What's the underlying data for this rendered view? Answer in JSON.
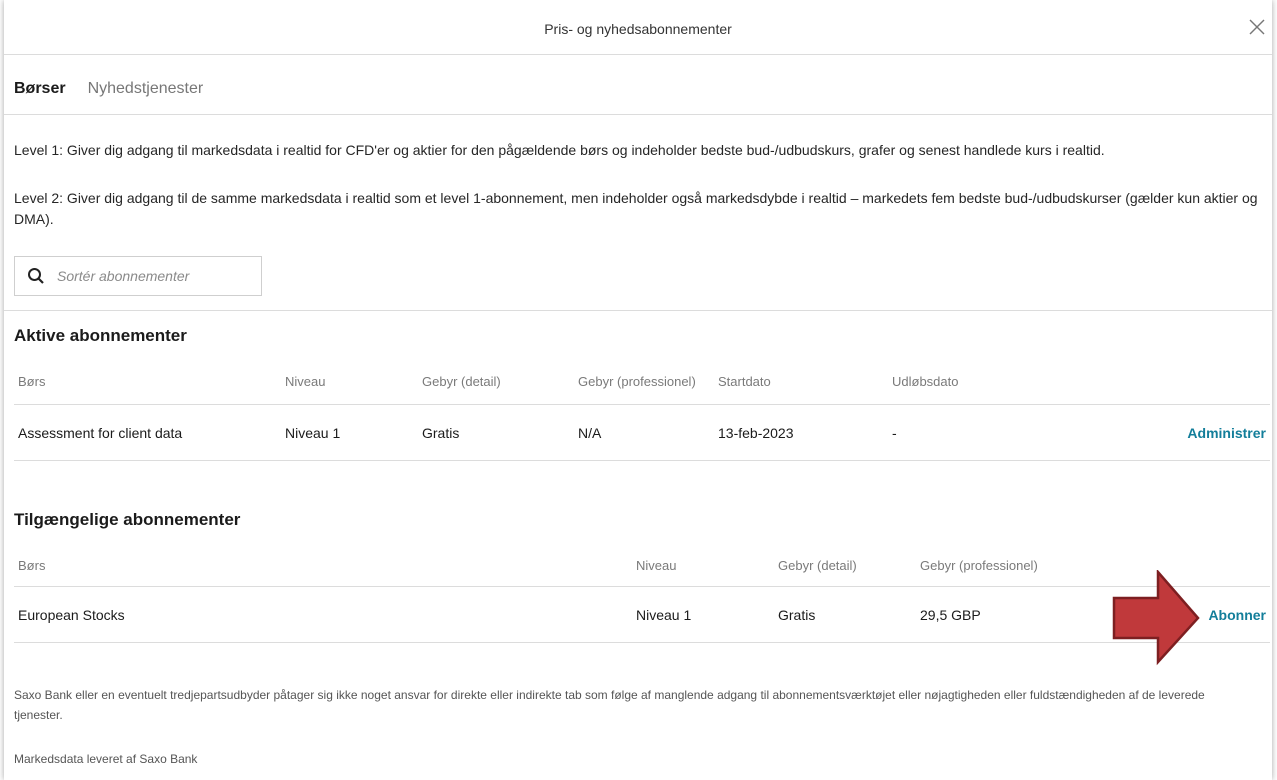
{
  "dialog": {
    "title": "Pris- og nyhedsabonnementer"
  },
  "tabs": [
    {
      "label": "Børser",
      "active": true
    },
    {
      "label": "Nyhedstjenester",
      "active": false
    }
  ],
  "intro": {
    "level1": "Level 1: Giver dig adgang til markedsdata i realtid for CFD'er og aktier for den pågældende børs og indeholder bedste bud-/udbudskurs, grafer og senest handlede kurs i realtid.",
    "level2": "Level 2: Giver dig adgang til de samme markedsdata i realtid som et level 1-abonnement, men indeholder også markedsdybde i realtid – markedets fem bedste bud-/udbudskurser (gælder kun aktier og DMA)."
  },
  "search": {
    "placeholder": "Sortér abonnementer",
    "value": ""
  },
  "active": {
    "heading": "Aktive abonnementer",
    "columns": [
      "Børs",
      "Niveau",
      "Gebyr (detail)",
      "Gebyr (professionel)",
      "Startdato",
      "Udløbsdato"
    ],
    "rows": [
      {
        "exchange": "Assessment for client data",
        "level": "Niveau 1",
        "fee_retail": "Gratis",
        "fee_pro": "N/A",
        "start": "13-feb-2023",
        "expiry": "-",
        "action": "Administrer"
      }
    ]
  },
  "available": {
    "heading": "Tilgængelige abonnementer",
    "columns": [
      "Børs",
      "Niveau",
      "Gebyr (detail)",
      "Gebyr (professionel)"
    ],
    "rows": [
      {
        "exchange": "European Stocks",
        "level": "Niveau 1",
        "fee_retail": "Gratis",
        "fee_pro": "29,5 GBP",
        "action": "Abonner"
      }
    ]
  },
  "footer": {
    "disclaimer": "Saxo Bank eller en eventuelt tredjepartsudbyder påtager sig ikke noget ansvar for direkte eller indirekte tab som følge af manglende adgang til abonnementsværktøjet eller nøjagtigheden eller fuldstændigheden af de leverede tjenester.",
    "provider": "Markedsdata leveret af Saxo Bank"
  },
  "colors": {
    "link": "#137e9a",
    "annotation_arrow": "#c0393b"
  },
  "icons": {
    "close": "close-icon",
    "search": "search-icon",
    "annotation": "arrow-right-annotation"
  }
}
